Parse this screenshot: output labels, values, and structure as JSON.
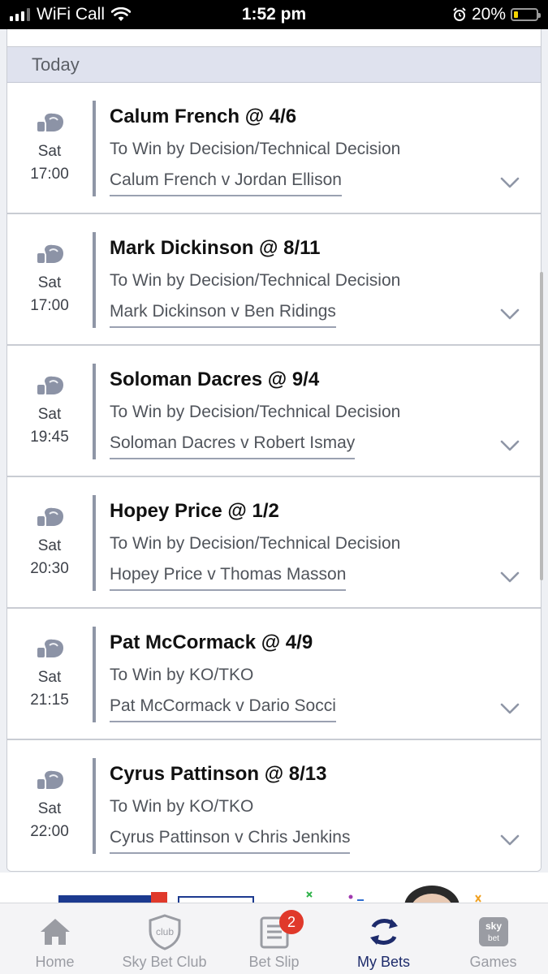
{
  "status_bar": {
    "carrier": "WiFi Call",
    "time": "1:52 pm",
    "battery": "20%",
    "battery_level": 0.2
  },
  "section": {
    "day_label": "Today"
  },
  "bets": [
    {
      "title": "Calum French @ 4/6",
      "market": "To Win by Decision/Technical Decision",
      "event": "Calum French v Jordan Ellison",
      "day": "Sat",
      "time": "17:00"
    },
    {
      "title": "Mark Dickinson @ 8/11",
      "market": "To Win by Decision/Technical Decision",
      "event": "Mark Dickinson v Ben Ridings",
      "day": "Sat",
      "time": "17:00"
    },
    {
      "title": "Soloman Dacres @ 9/4",
      "market": "To Win by Decision/Technical Decision",
      "event": "Soloman Dacres v Robert Ismay",
      "day": "Sat",
      "time": "19:45"
    },
    {
      "title": "Hopey Price @ 1/2",
      "market": "To Win by Decision/Technical Decision",
      "event": "Hopey Price v Thomas Masson",
      "day": "Sat",
      "time": "20:30"
    },
    {
      "title": "Pat McCormack @ 4/9",
      "market": "To Win by KO/TKO",
      "event": "Pat McCormack v Dario Socci",
      "day": "Sat",
      "time": "21:15"
    },
    {
      "title": "Cyrus Pattinson @ 8/13",
      "market": "To Win by KO/TKO",
      "event": "Cyrus Pattinson v Chris Jenkins",
      "day": "Sat",
      "time": "22:00"
    }
  ],
  "tabs": [
    {
      "label": "Home",
      "icon": "home-icon"
    },
    {
      "label": "Sky Bet Club",
      "icon": "club-shield-icon",
      "icon_text": "club"
    },
    {
      "label": "Bet Slip",
      "icon": "betslip-icon",
      "badge": "2"
    },
    {
      "label": "My Bets",
      "icon": "my-bets-icon",
      "active": true
    },
    {
      "label": "Games",
      "icon": "games-icon",
      "icon_text_top": "sky",
      "icon_text_bottom": "bet"
    }
  ],
  "colors": {
    "accent": "#1d2b6b",
    "badge": "#e0392b",
    "header_bg": "#dfe2ee",
    "divider": "#8f96a6"
  }
}
